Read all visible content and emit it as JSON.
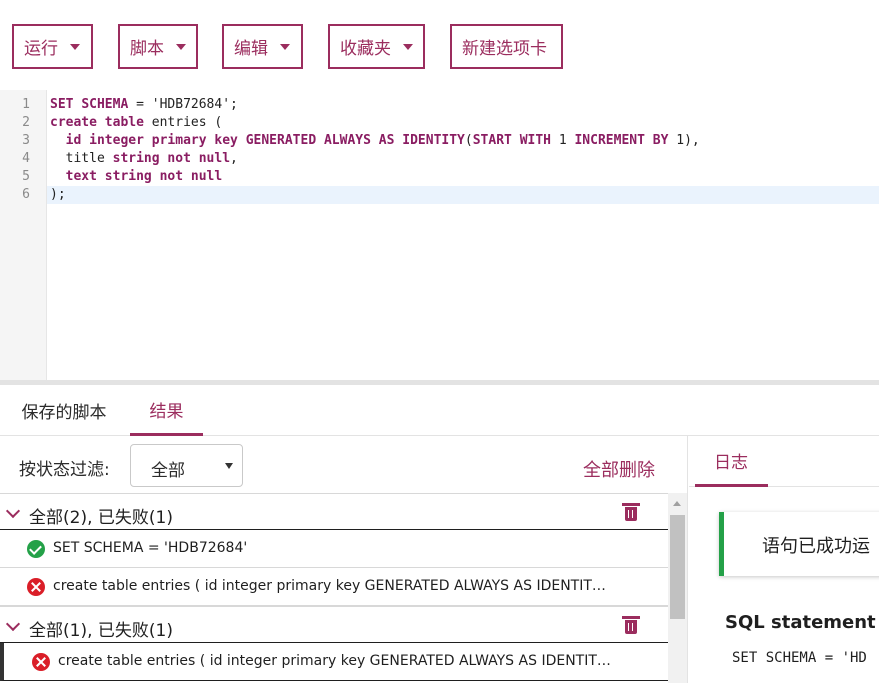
{
  "toolbar": {
    "run": "运行",
    "script": "脚本",
    "edit": "编辑",
    "favorites": "收藏夹",
    "new_tab": "新建选项卡"
  },
  "editor": {
    "line_numbers": [
      "1",
      "2",
      "3",
      "4",
      "5",
      "6"
    ],
    "lines": [
      "SET SCHEMA = 'HDB72684';",
      "create table entries (",
      "  id integer primary key GENERATED ALWAYS AS IDENTITY(START WITH 1 INCREMENT BY 1),",
      "  title string not null,",
      "  text string not null",
      ");"
    ]
  },
  "tabs": {
    "saved_scripts": "保存的脚本",
    "results": "结果"
  },
  "filter": {
    "label": "按状态过滤:",
    "value": "全部",
    "delete_all": "全部删除"
  },
  "groups": [
    {
      "title": "全部(2), 已失败(1)",
      "items": [
        {
          "status": "success",
          "text": "SET SCHEMA = 'HDB72684'"
        },
        {
          "status": "error",
          "text": "create table entries ( id integer primary key GENERATED ALWAYS AS IDENTITY(S..."
        }
      ]
    },
    {
      "title": "全部(1), 已失败(1)",
      "items": [
        {
          "status": "error",
          "text": "create table entries ( id integer primary key GENERATED ALWAYS AS IDENTITY(..."
        }
      ]
    }
  ],
  "log": {
    "tab": "日志",
    "message": "语句已成功运",
    "sql_title": "SQL statement",
    "sql_text": "SET SCHEMA = 'HD"
  },
  "colors": {
    "accent": "#9b2d5e",
    "success": "#24a148",
    "error": "#da1e28"
  }
}
